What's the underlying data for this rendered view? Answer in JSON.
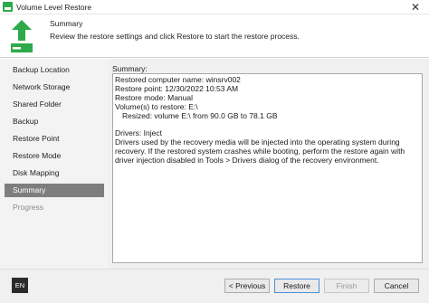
{
  "window": {
    "title": "Volume Level Restore",
    "close_glyph": "✕"
  },
  "header": {
    "title": "Summary",
    "subtitle": "Review the restore settings and click Restore to start the restore process.",
    "icon": "restore-arrow-icon"
  },
  "sidebar": {
    "items": [
      {
        "label": "Backup Location"
      },
      {
        "label": "Network Storage"
      },
      {
        "label": "Shared Folder"
      },
      {
        "label": "Backup"
      },
      {
        "label": "Restore Point"
      },
      {
        "label": "Restore Mode"
      },
      {
        "label": "Disk Mapping"
      },
      {
        "label": "Summary"
      },
      {
        "label": "Progress"
      }
    ],
    "active_index": 7
  },
  "summary": {
    "label": "Summary:",
    "lines": [
      "Restored computer name: winsrv002",
      "Restore point: 12/30/2022 10:53 AM",
      "Restore mode: Manual",
      "Volume(s) to restore: E:\\",
      "Resized: volume E:\\ from 90.0 GB to 78.1 GB",
      "Drivers: Inject",
      "Drivers used by the recovery media will be injected into the operating system during recovery. If the restored system crashes while booting, perform the restore again with driver injection disabled in Tools > Drivers dialog of the recovery environment."
    ]
  },
  "footer": {
    "language": "EN",
    "previous_label": "< Previous",
    "restore_label": "Restore",
    "finish_label": "Finish",
    "cancel_label": "Cancel"
  },
  "colors": {
    "accent_green": "#2eaa4a",
    "active_nav_bg": "#7e7e7e",
    "primary_border": "#4c8fd6"
  }
}
